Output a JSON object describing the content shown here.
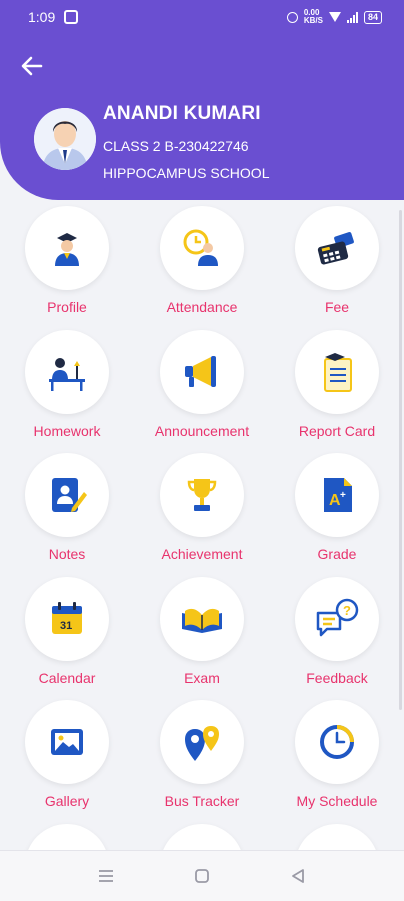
{
  "status_bar": {
    "time": "1:09",
    "network_speed": "0.00\nKB/S",
    "battery": "84"
  },
  "header": {
    "back_icon": "arrow-left-icon",
    "name": "ANANDI KUMARI",
    "class": "CLASS 2 B-230422746",
    "school": "HIPPOCAMPUS SCHOOL"
  },
  "menu": {
    "items": [
      {
        "label": "Profile",
        "icon": "graduate-student-icon"
      },
      {
        "label": "Attendance",
        "icon": "clock-person-icon"
      },
      {
        "label": "Fee",
        "icon": "calculator-money-icon"
      },
      {
        "label": "Homework",
        "icon": "study-desk-icon"
      },
      {
        "label": "Announcement",
        "icon": "megaphone-icon"
      },
      {
        "label": "Report Card",
        "icon": "report-card-icon"
      },
      {
        "label": "Notes",
        "icon": "notebook-pencil-icon"
      },
      {
        "label": "Achievement",
        "icon": "trophy-icon"
      },
      {
        "label": "Grade",
        "icon": "grade-a-plus-icon"
      },
      {
        "label": "Calendar",
        "icon": "calendar-icon"
      },
      {
        "label": "Exam",
        "icon": "open-book-icon"
      },
      {
        "label": "Feedback",
        "icon": "chat-question-icon"
      },
      {
        "label": "Gallery",
        "icon": "gallery-image-icon"
      },
      {
        "label": "Bus Tracker",
        "icon": "map-pins-icon"
      },
      {
        "label": "My Schedule",
        "icon": "schedule-clock-icon"
      }
    ]
  },
  "colors": {
    "header": "#6a4fd1",
    "label": "#e8336d",
    "icon_blue": "#1f57c3",
    "icon_yellow": "#f5c518"
  },
  "nav": {
    "recents_icon": "menu-lines-icon",
    "home_icon": "home-square-icon",
    "back_icon": "triangle-back-icon"
  }
}
